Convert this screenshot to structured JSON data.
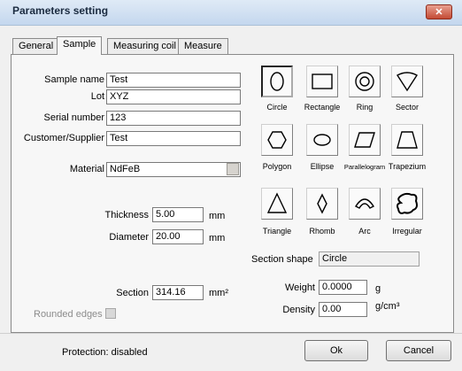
{
  "window": {
    "title": "Parameters setting",
    "close_glyph": "✕"
  },
  "tabs": [
    {
      "label": "General"
    },
    {
      "label": "Sample"
    },
    {
      "label": "Measuring coil"
    },
    {
      "label": "Measure"
    }
  ],
  "form": {
    "sample_name": {
      "label": "Sample name",
      "value": "Test"
    },
    "lot": {
      "label": "Lot",
      "value": "XYZ"
    },
    "serial_number": {
      "label": "Serial number",
      "value": "123"
    },
    "customer": {
      "label": "Customer/Supplier",
      "value": "Test"
    },
    "material": {
      "label": "Material",
      "value": "NdFeB"
    },
    "thickness": {
      "label": "Thickness",
      "value": "5.00",
      "unit": "mm"
    },
    "diameter": {
      "label": "Diameter",
      "value": "20.00",
      "unit": "mm"
    },
    "section": {
      "label": "Section",
      "value": "314.16",
      "unit": "mm²"
    },
    "rounded_edges": {
      "label": "Rounded edges",
      "checked": false
    },
    "section_shape": {
      "label": "Section shape",
      "value": "Circle"
    },
    "weight": {
      "label": "Weight",
      "value": "0.0000",
      "unit": "g"
    },
    "density": {
      "label": "Density",
      "value": "0.00",
      "unit": "g/cm³"
    }
  },
  "shapes": [
    {
      "label": "Circle",
      "icon": "circle-icon",
      "selected": true
    },
    {
      "label": "Rectangle",
      "icon": "rectangle-icon"
    },
    {
      "label": "Ring",
      "icon": "ring-icon"
    },
    {
      "label": "Sector",
      "icon": "sector-icon"
    },
    {
      "label": "Polygon",
      "icon": "polygon-icon"
    },
    {
      "label": "Ellipse",
      "icon": "ellipse-icon"
    },
    {
      "label": "Parallelogram",
      "icon": "parallelogram-icon"
    },
    {
      "label": "Trapezium",
      "icon": "trapezium-icon"
    },
    {
      "label": "Triangle",
      "icon": "triangle-icon"
    },
    {
      "label": "Rhomb",
      "icon": "rhomb-icon"
    },
    {
      "label": "Arc",
      "icon": "arc-icon"
    },
    {
      "label": "Irregular",
      "icon": "irregular-icon"
    }
  ],
  "footer": {
    "protection": "Protection: disabled",
    "ok_label": "Ok",
    "cancel_label": "Cancel"
  }
}
